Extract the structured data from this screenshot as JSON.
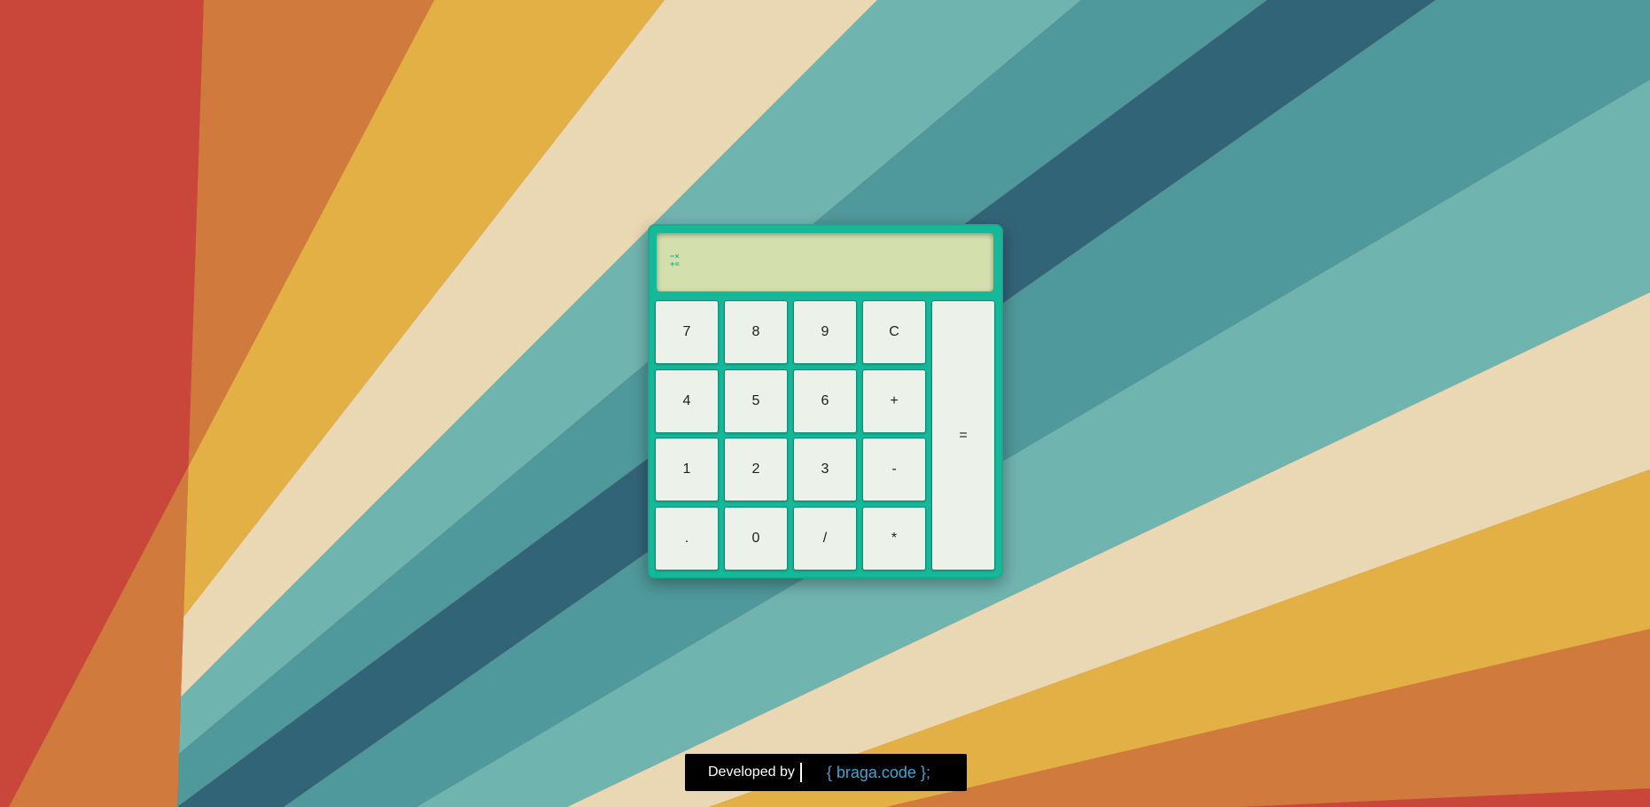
{
  "calculator": {
    "display_value": "",
    "display_icon_top": "−×",
    "display_icon_bottom": "+=",
    "keys": {
      "k7": "7",
      "k8": "8",
      "k9": "9",
      "clear": "C",
      "k4": "4",
      "k5": "5",
      "k6": "6",
      "plus": "+",
      "k1": "1",
      "k2": "2",
      "k3": "3",
      "minus": "-",
      "dot": ".",
      "k0": "0",
      "divide": "/",
      "multiply": "*",
      "equals": "="
    }
  },
  "footer": {
    "label": "Developed by",
    "brand": "{ braga.code };"
  },
  "colors": {
    "calculator_body": "#16b89a",
    "display_bg": "#d4dfae",
    "key_bg": "#ecf1ea",
    "footer_bg": "#000000",
    "brand_text": "#3aa7d9"
  }
}
